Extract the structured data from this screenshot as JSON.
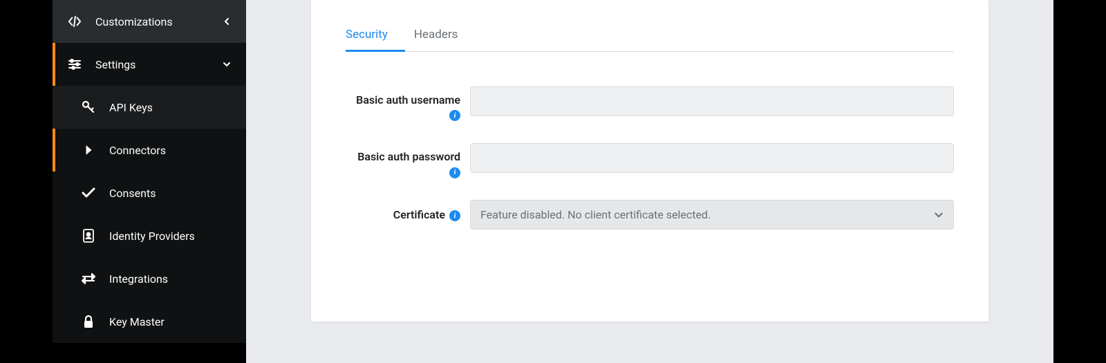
{
  "sidebar": {
    "items": [
      {
        "label": "Customizations",
        "icon": "code-icon"
      },
      {
        "label": "Settings",
        "icon": "sliders-icon"
      },
      {
        "label": "API Keys",
        "icon": "key-icon"
      },
      {
        "label": "Connectors",
        "icon": "chevron-right-icon"
      },
      {
        "label": "Consents",
        "icon": "check-icon"
      },
      {
        "label": "Identity Providers",
        "icon": "id-badge-icon"
      },
      {
        "label": "Integrations",
        "icon": "swap-icon"
      },
      {
        "label": "Key Master",
        "icon": "lock-icon"
      }
    ]
  },
  "tabs": [
    {
      "label": "Security",
      "active": true
    },
    {
      "label": "Headers",
      "active": false
    }
  ],
  "form": {
    "username_label": "Basic auth username",
    "username_value": "",
    "password_label": "Basic auth password",
    "password_value": "",
    "certificate_label": "Certificate",
    "certificate_value": "Feature disabled. No client certificate selected."
  }
}
